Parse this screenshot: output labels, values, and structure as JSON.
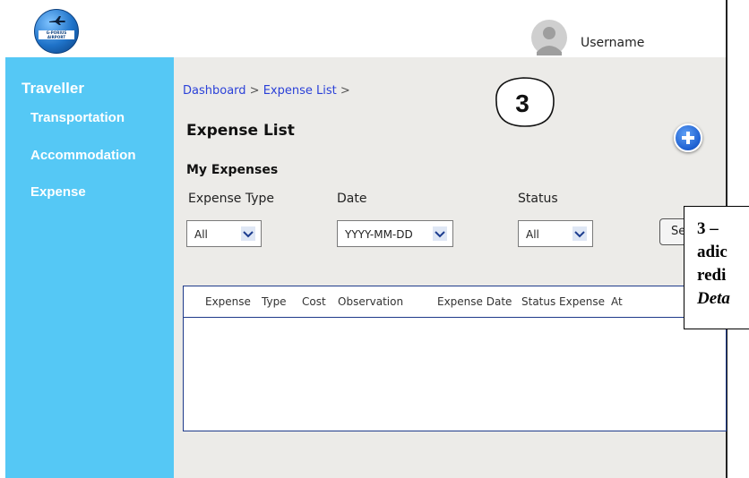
{
  "header": {
    "logo_text": "G-PORIUS AIRPORT",
    "username": "Username"
  },
  "sidebar": {
    "title": "Traveller",
    "items": [
      {
        "label": "Transportation"
      },
      {
        "label": "Accommodation"
      },
      {
        "label": "Expense"
      }
    ]
  },
  "breadcrumb": {
    "items": [
      {
        "label": "Dashboard"
      },
      {
        "label": "Expense List"
      }
    ],
    "separator": " > "
  },
  "main": {
    "title": "Expense List",
    "section_title": "My Expenses",
    "add_icon": "plus-circle-icon"
  },
  "filters": {
    "expense_type": {
      "label": "Expense Type",
      "value": "All"
    },
    "date": {
      "label": "Date",
      "value": "YYYY-MM-DD"
    },
    "status": {
      "label": "Status",
      "value": "All"
    },
    "search_label": "Se"
  },
  "table": {
    "columns": [
      "Expense",
      "Type",
      "Cost",
      "Observation",
      "Expense Date",
      "Status Expense",
      "At"
    ],
    "rows": []
  },
  "annotation": {
    "step": "3",
    "note_lines": [
      "3 – ",
      "adic",
      "redi",
      "Deta"
    ]
  },
  "colors": {
    "sidebar": "#55c8f5",
    "content_bg": "#ecebe8",
    "link": "#2b41d8",
    "table_border": "#1e3a8a"
  }
}
